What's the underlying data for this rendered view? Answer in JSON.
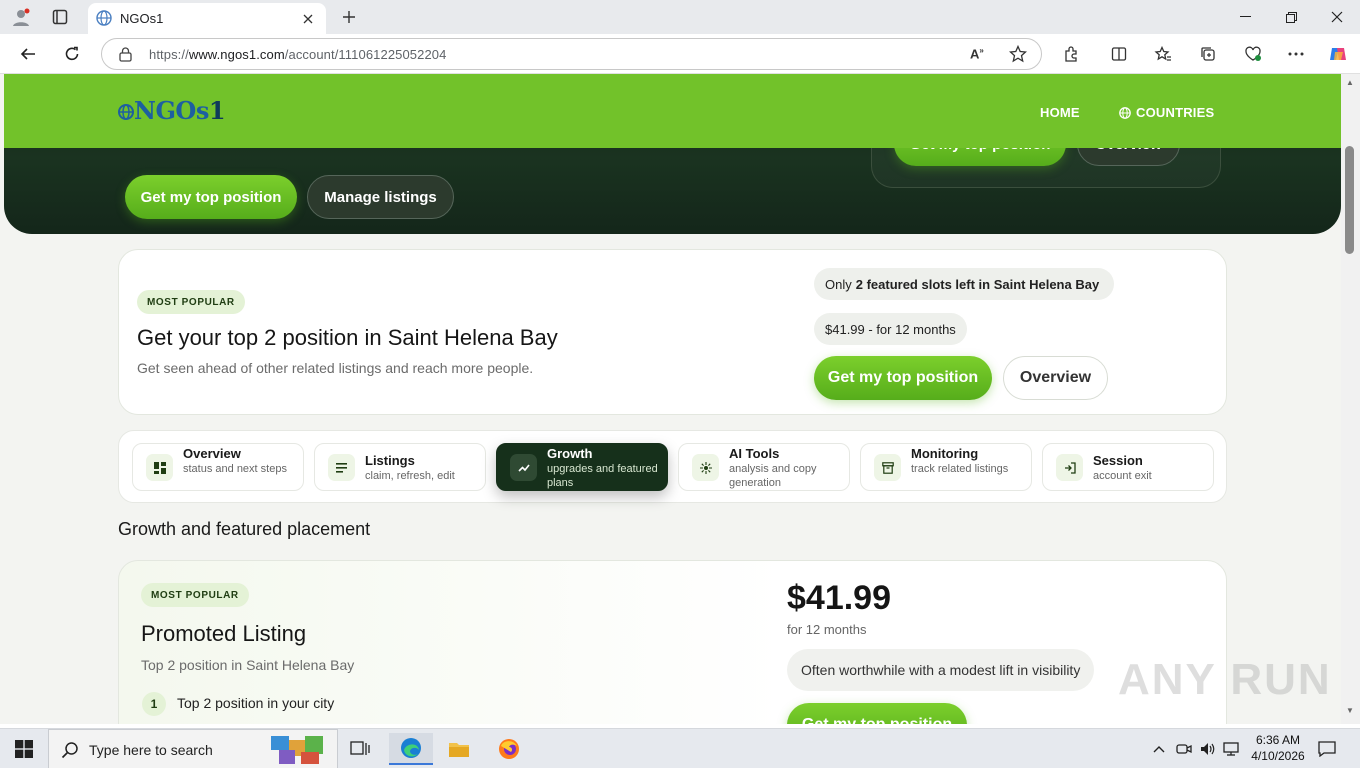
{
  "browser": {
    "tab_title": "NGOs1",
    "url_scheme": "https://",
    "url_host": "www.ngos1.com",
    "url_path": "/account/111061225052204"
  },
  "header": {
    "logo": "NGOs",
    "logo_suffix": "1",
    "nav_home": "HOME",
    "nav_countries": "COUNTRIES"
  },
  "hero": {
    "primary_button": "Get my top position",
    "secondary_button": "Manage listings",
    "card_primary_button": "Get my top position",
    "card_secondary_button": "Overview"
  },
  "featured": {
    "badge": "MOST POPULAR",
    "title": "Get your top 2 position in Saint Helena Bay",
    "subtitle": "Get seen ahead of other related listings and reach more people.",
    "slots_prefix": "Only",
    "slots_bold": "2 featured slots left in Saint Helena Bay",
    "price_pill": "$41.99 - for 12 months",
    "primary_button": "Get my top position",
    "secondary_button": "Overview"
  },
  "tabs": [
    {
      "title": "Overview",
      "sub": "status and next steps",
      "icon": "grid-icon"
    },
    {
      "title": "Listings",
      "sub": "claim, refresh, edit",
      "icon": "list-icon"
    },
    {
      "title": "Growth",
      "sub": "upgrades and featured plans",
      "icon": "trend-icon"
    },
    {
      "title": "AI Tools",
      "sub": "analysis and copy generation",
      "icon": "spark-icon"
    },
    {
      "title": "Monitoring",
      "sub": "track related listings",
      "icon": "archive-icon"
    },
    {
      "title": "Session",
      "sub": "account exit",
      "icon": "logout-icon"
    }
  ],
  "section_title": "Growth and featured placement",
  "promo": {
    "badge": "MOST POPULAR",
    "title": "Promoted Listing",
    "subtitle": "Top 2 position in Saint Helena Bay",
    "feature_num": "1",
    "feature_text": "Top 2 position in your city",
    "price": "$41.99",
    "term": "for 12 months",
    "note": "Often worthwhile with a modest lift in visibility",
    "button": "Get my top position"
  },
  "watermark": "ANY RUN",
  "taskbar": {
    "search_placeholder": "Type here to search",
    "time": "6:36 AM",
    "date": "4/10/2026"
  },
  "colors": {
    "brand_green": "#72c22a",
    "dark_green": "#16301b",
    "logo_blue": "#1d5fa0"
  }
}
